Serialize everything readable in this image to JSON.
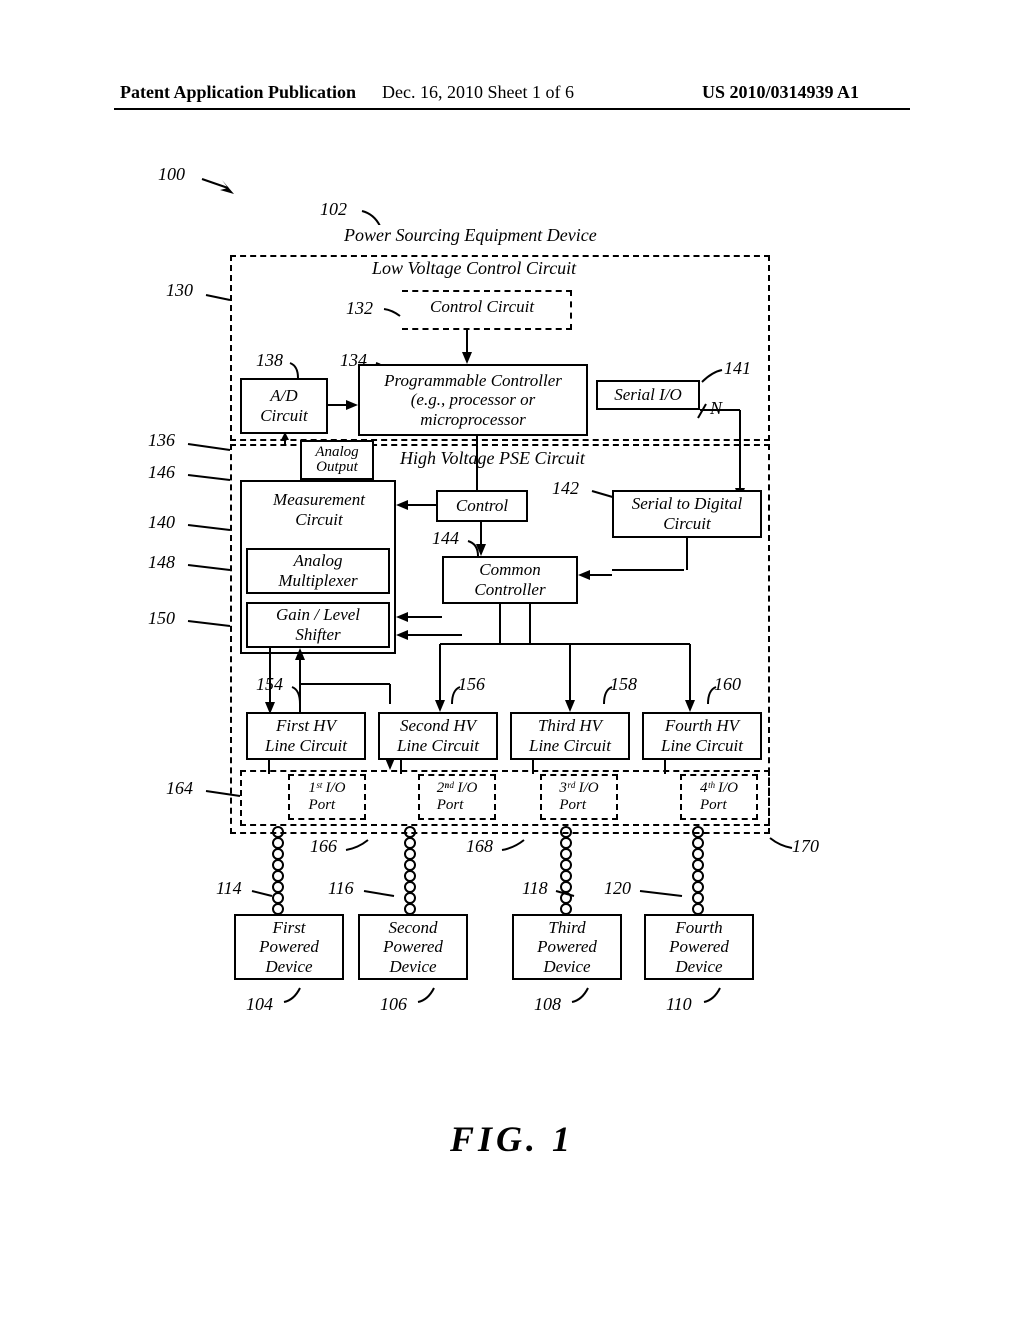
{
  "header": {
    "left": "Patent Application Publication",
    "mid": "Dec. 16, 2010  Sheet 1 of 6",
    "right": "US 2010/0314939 A1"
  },
  "refs": {
    "r100": "100",
    "r102": "102",
    "r130": "130",
    "r132": "132",
    "r134": "134",
    "r136": "136",
    "r138": "138",
    "r140": "140",
    "r141": "141",
    "r142": "142",
    "r144": "144",
    "r146": "146",
    "r148": "148",
    "r150": "150",
    "r154": "154",
    "r156": "156",
    "r158": "158",
    "r160": "160",
    "r164": "164",
    "r166": "166",
    "r168": "168",
    "r170": "170",
    "r114": "114",
    "r116": "116",
    "r118": "118",
    "r120": "120",
    "r104": "104",
    "r106": "106",
    "r108": "108",
    "r110": "110"
  },
  "titles": {
    "pse": "Power Sourcing Equipment Device",
    "lvcc": "Low Voltage Control Circuit",
    "ctrl": "Control Circuit",
    "hvpse": "High Voltage PSE Circuit"
  },
  "blocks": {
    "ad": "A/D\nCircuit",
    "prog": "Programmable Controller\n(e.g., processor or\nmicroprocessor",
    "sio": "Serial I/O",
    "meas": "Measurement\nCircuit",
    "control": "Control",
    "s2d": "Serial to Digital\nCircuit",
    "amux": "Analog\nMultiplexer",
    "common": "Common\nController",
    "gls": "Gain / Level\nShifter",
    "ao": "Analog\nOutput",
    "n": "N",
    "hv1": "First HV\nLine Circuit",
    "hv2": "Second HV\nLine Circuit",
    "hv3": "Third HV\nLine Circuit",
    "hv4": "Fourth HV\nLine Circuit",
    "io1": "1ˢᵗ I/O\nPort",
    "io2": "2ⁿᵈ I/O\nPort",
    "io3": "3ʳᵈ I/O\nPort",
    "io4": "4ᵗʰ I/O\nPort",
    "pd1": "First\nPowered\nDevice",
    "pd2": "Second\nPowered\nDevice",
    "pd3": "Third\nPowered\nDevice",
    "pd4": "Fourth\nPowered\nDevice"
  },
  "figure": "FIG.  1"
}
